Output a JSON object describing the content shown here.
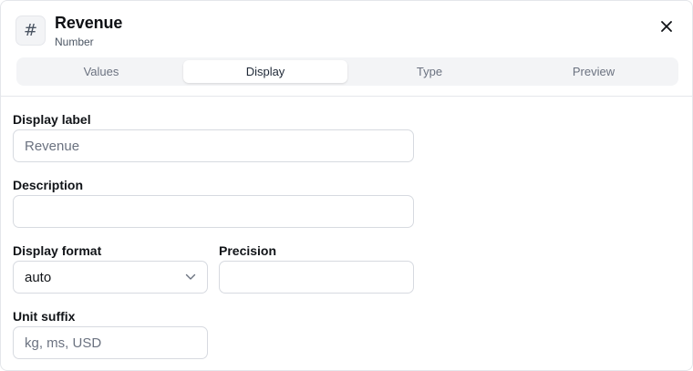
{
  "header": {
    "icon_glyph": "#",
    "icon_name": "hash-icon",
    "title": "Revenue",
    "subtitle": "Number",
    "close_icon": "close-icon"
  },
  "tabs": [
    {
      "label": "Values",
      "active": false
    },
    {
      "label": "Display",
      "active": true
    },
    {
      "label": "Type",
      "active": false
    },
    {
      "label": "Preview",
      "active": false
    }
  ],
  "form": {
    "display_label": {
      "label": "Display label",
      "placeholder": "Revenue",
      "value": ""
    },
    "description": {
      "label": "Description",
      "placeholder": "",
      "value": ""
    },
    "display_format": {
      "label": "Display format",
      "value": "auto"
    },
    "precision": {
      "label": "Precision",
      "placeholder": "",
      "value": ""
    },
    "unit_suffix": {
      "label": "Unit suffix",
      "placeholder": "kg, ms, USD",
      "value": ""
    }
  },
  "colors": {
    "border": "#d7dae0",
    "tab_track": "#f3f4f6",
    "text_primary": "#111418",
    "text_muted": "#6b7280"
  }
}
